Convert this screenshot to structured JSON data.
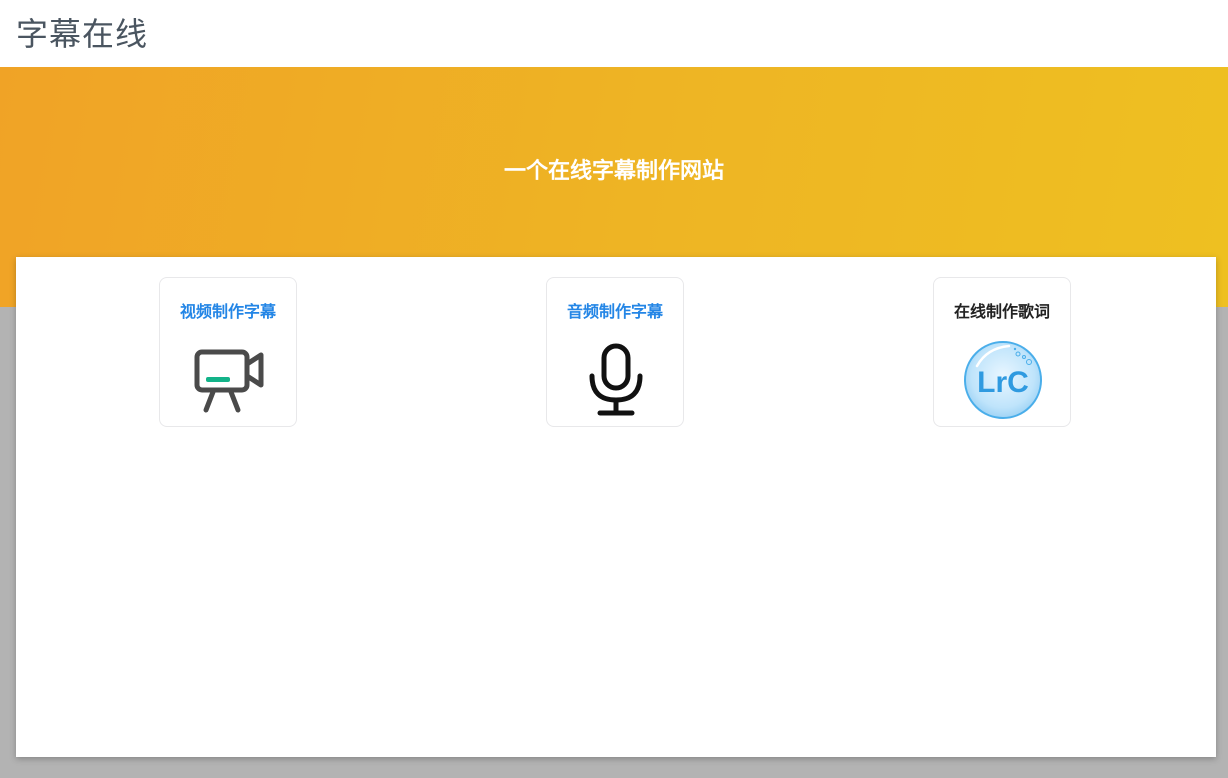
{
  "header": {
    "title": "字幕在线"
  },
  "hero": {
    "tagline": "一个在线字幕制作网站"
  },
  "cards": [
    {
      "label": "视频制作字幕",
      "icon": "video-camera-icon",
      "color": "#2486e6"
    },
    {
      "label": "音频制作字幕",
      "icon": "microphone-icon",
      "color": "#2486e6"
    },
    {
      "label": "在线制作歌词",
      "icon": "lrc-icon",
      "color": "#222222",
      "icon_text": "LrC"
    }
  ],
  "colors": {
    "hero_start": "#f0a326",
    "hero_end": "#eec021",
    "link_blue": "#2486e6",
    "accent_green": "#13b389",
    "lrc_blue": "#2f9ae0"
  }
}
